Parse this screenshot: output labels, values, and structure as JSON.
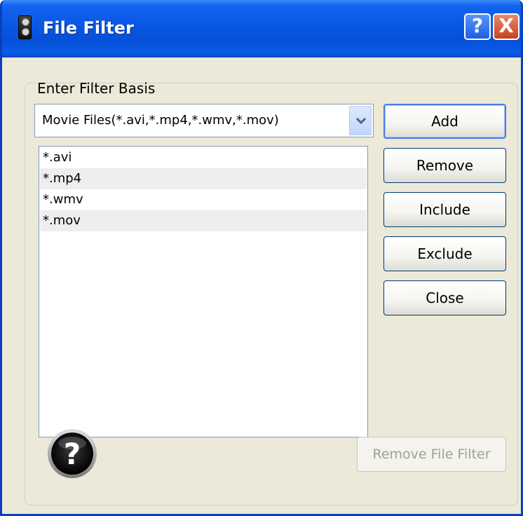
{
  "window": {
    "title": "File Filter",
    "help_button": "?",
    "close_button": "X"
  },
  "filter": {
    "label": "Enter Filter Basis",
    "selected": "Movie Files(*.avi,*.mp4,*.wmv,*.mov)"
  },
  "list": {
    "items": [
      "*.avi",
      "*.mp4",
      "*.wmv",
      "*.mov"
    ]
  },
  "buttons": {
    "add": "Add",
    "remove": "Remove",
    "include": "Include",
    "exclude": "Exclude",
    "close": "Close",
    "remove_file_filter": "Remove File Filter"
  },
  "icons": {
    "app": "speaker-icon",
    "help": "help-orb-icon",
    "dropdown": "chevron-down-icon"
  }
}
